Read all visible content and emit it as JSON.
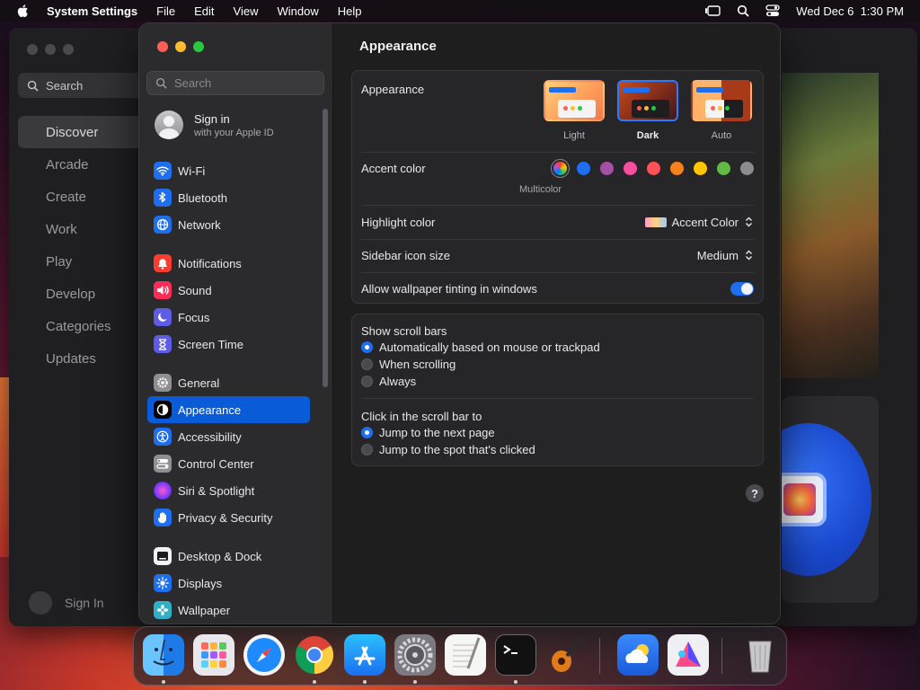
{
  "menubar": {
    "app_name": "System Settings",
    "menus": [
      "File",
      "Edit",
      "View",
      "Window",
      "Help"
    ],
    "datetime": "Wed Dec 6  1:30 PM"
  },
  "background_app": {
    "search_placeholder": "Search",
    "nav": [
      "Discover",
      "Arcade",
      "Create",
      "Work",
      "Play",
      "Develop",
      "Categories",
      "Updates"
    ],
    "selected": "Discover",
    "sign_in": "Sign In"
  },
  "sidebar": {
    "search_placeholder": "Search",
    "account": {
      "title": "Sign in",
      "subtitle": "with your Apple ID"
    },
    "groups": [
      [
        {
          "label": "Wi-Fi",
          "icon": "wifi-icon",
          "color": "#1e6ff0"
        },
        {
          "label": "Bluetooth",
          "icon": "bluetooth-icon",
          "color": "#1e6ff0"
        },
        {
          "label": "Network",
          "icon": "globe-icon",
          "color": "#1e6ff0"
        }
      ],
      [
        {
          "label": "Notifications",
          "icon": "bell-icon",
          "color": "#ff3b30"
        },
        {
          "label": "Sound",
          "icon": "speaker-icon",
          "color": "#ff2d55"
        },
        {
          "label": "Focus",
          "icon": "moon-icon",
          "color": "#5e5ce6"
        },
        {
          "label": "Screen Time",
          "icon": "hourglass-icon",
          "color": "#5e5ce6"
        }
      ],
      [
        {
          "label": "General",
          "icon": "gear-icon",
          "color": "#8e8e93"
        },
        {
          "label": "Appearance",
          "icon": "appearance-icon",
          "color": "#000000",
          "selected": true
        },
        {
          "label": "Accessibility",
          "icon": "accessibility-icon",
          "color": "#1e6ff0"
        },
        {
          "label": "Control Center",
          "icon": "control-center-icon",
          "color": "#8e8e93"
        },
        {
          "label": "Siri & Spotlight",
          "icon": "siri-icon",
          "color": "#bf5af2"
        },
        {
          "label": "Privacy & Security",
          "icon": "hand-icon",
          "color": "#1e6ff0"
        }
      ],
      [
        {
          "label": "Desktop & Dock",
          "icon": "dock-icon",
          "color": "#1c1c1e"
        },
        {
          "label": "Displays",
          "icon": "sun-icon",
          "color": "#1e6ff0"
        },
        {
          "label": "Wallpaper",
          "icon": "flower-icon",
          "color": "#30b0c7"
        }
      ]
    ]
  },
  "main": {
    "title": "Appearance",
    "appearance_label": "Appearance",
    "appearance_options": [
      {
        "label": "Light",
        "selected": false
      },
      {
        "label": "Dark",
        "selected": true
      },
      {
        "label": "Auto",
        "selected": false
      }
    ],
    "accent_label": "Accent color",
    "accent_selected_caption": "Multicolor",
    "accent_colors": [
      "multicolor",
      "#1e6ff0",
      "#a550a7",
      "#f74f9e",
      "#ff5257",
      "#f7821b",
      "#ffc600",
      "#62ba46",
      "#8c8c8c"
    ],
    "highlight_label": "Highlight color",
    "highlight_value": "Accent Color",
    "icon_size_label": "Sidebar icon size",
    "icon_size_value": "Medium",
    "tinting_label": "Allow wallpaper tinting in windows",
    "tinting_on": true,
    "scroll_bars_label": "Show scroll bars",
    "scroll_bars_options": [
      {
        "label": "Automatically based on mouse or trackpad",
        "selected": true
      },
      {
        "label": "When scrolling",
        "selected": false
      },
      {
        "label": "Always",
        "selected": false
      }
    ],
    "click_label": "Click in the scroll bar to",
    "click_options": [
      {
        "label": "Jump to the next page",
        "selected": true
      },
      {
        "label": "Jump to the spot that's clicked",
        "selected": false
      }
    ],
    "help": "?"
  },
  "dock": {
    "apps": [
      "Finder",
      "Launchpad",
      "Safari",
      "Chrome",
      "App Store",
      "System Settings",
      "TextEdit",
      "Terminal",
      "GarageBand",
      "Weather",
      "Affinity",
      "Trash"
    ],
    "running": [
      "Finder",
      "Chrome",
      "App Store",
      "System Settings",
      "Terminal"
    ]
  }
}
